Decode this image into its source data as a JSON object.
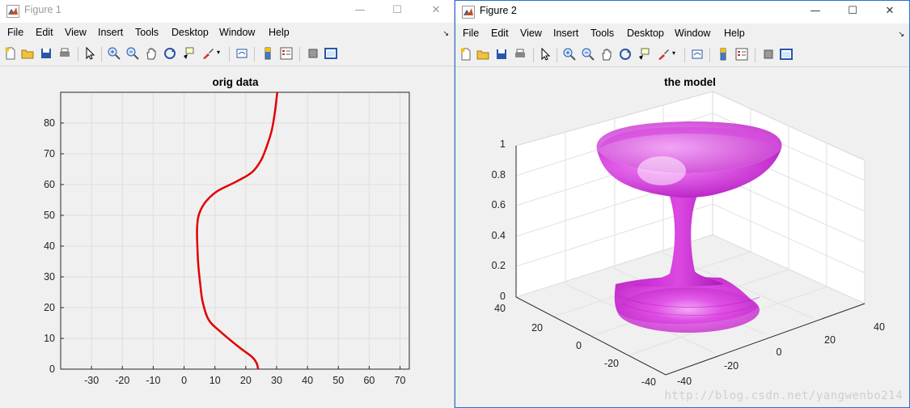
{
  "figure1": {
    "title": "Figure 1",
    "menu": [
      "File",
      "Edit",
      "View",
      "Insert",
      "Tools",
      "Desktop",
      "Window",
      "Help"
    ],
    "window_buttons": {
      "minimize": "—",
      "maximize": "☐",
      "close": "✕"
    },
    "axes_title": "orig data",
    "chart_data": {
      "type": "line",
      "title": "orig data",
      "xlabel": "",
      "ylabel": "",
      "xlim": [
        -40,
        73
      ],
      "ylim": [
        0,
        90
      ],
      "xticks": [
        -30,
        -20,
        -10,
        0,
        10,
        20,
        30,
        40,
        50,
        60,
        70
      ],
      "yticks": [
        0,
        10,
        20,
        30,
        40,
        50,
        60,
        70,
        80
      ],
      "grid": true,
      "series_color": "#e00000",
      "x": [
        24,
        23.5,
        22,
        18,
        12,
        8,
        6,
        5.2,
        4.6,
        4.3,
        4.2,
        4.5,
        5.5,
        7.5,
        11,
        17,
        22,
        25,
        27,
        28.5,
        29.5,
        30.2
      ],
      "y": [
        0,
        2,
        4,
        7,
        12,
        16,
        22,
        28,
        34,
        40,
        45,
        49,
        52,
        55,
        58,
        61,
        64,
        68,
        73,
        78,
        84,
        90
      ]
    }
  },
  "figure2": {
    "title": "Figure 2",
    "menu": [
      "File",
      "Edit",
      "View",
      "Insert",
      "Tools",
      "Desktop",
      "Window",
      "Help"
    ],
    "window_buttons": {
      "minimize": "—",
      "maximize": "☐",
      "close": "✕"
    },
    "axes_title": "the model",
    "chart_data": {
      "type": "surface",
      "title": "the model",
      "zticks": [
        0,
        0.2,
        0.4,
        0.6,
        0.8,
        1
      ],
      "xticks": [
        -40,
        -20,
        0,
        20,
        40
      ],
      "yticks": [
        40,
        20,
        0,
        -20,
        -40
      ],
      "surface_color": "#e040e8",
      "grid": true
    },
    "watermark": "http://blog.csdn.net/yangwenbo214"
  }
}
